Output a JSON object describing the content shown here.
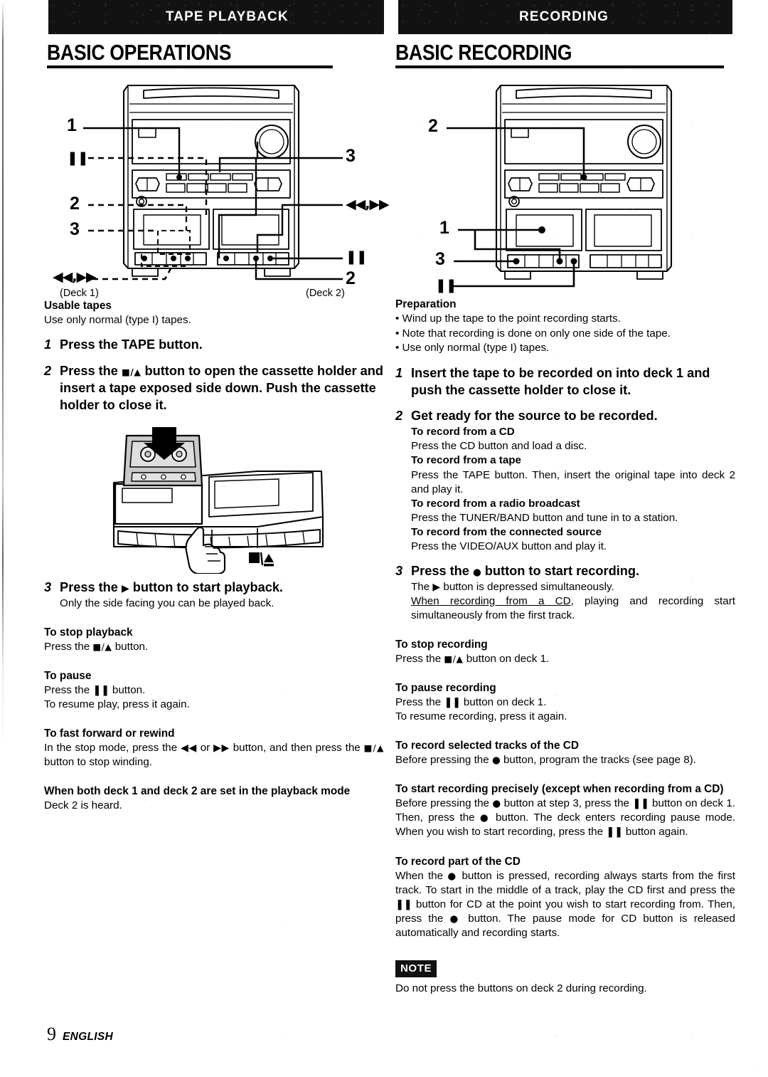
{
  "page": {
    "number": "9",
    "language": "ENGLISH"
  },
  "left_column": {
    "banner": "TAPE PLAYBACK",
    "heading": "BASIC OPERATIONS",
    "diagram": {
      "callouts": [
        {
          "id": "callout-1",
          "label": "1"
        },
        {
          "id": "callout-pause-deck1",
          "label": "❚❚"
        },
        {
          "id": "callout-2-left",
          "label": "2"
        },
        {
          "id": "callout-3-left",
          "label": "3"
        },
        {
          "id": "callout-ffrew-deck1",
          "label": "◀◀,▶▶"
        },
        {
          "id": "callout-3-right",
          "label": "3"
        },
        {
          "id": "callout-ffrew-deck2",
          "label": "◀◀,▶▶"
        },
        {
          "id": "callout-pause-deck2",
          "label": "❚❚"
        },
        {
          "id": "callout-2-right",
          "label": "2"
        }
      ],
      "deck1_label": "(Deck 1)",
      "deck2_label": "(Deck 2)",
      "cassette_button_label": "■/▲"
    },
    "usable_tapes": {
      "heading": "Usable tapes",
      "text": "Use only normal (type I) tapes."
    },
    "steps": [
      {
        "number": "1",
        "text": "Press the TAPE button."
      },
      {
        "number": "2",
        "text_before": "Press the ",
        "symbol": "■/▲",
        "text_after": " button to open the cassette holder and insert a tape exposed side down. Push the cassette holder to close it."
      },
      {
        "number": "3",
        "text_before": "Press the ",
        "symbol": "▶",
        "text_after": " button to start playback.",
        "sub": "Only the side facing you can be played back."
      }
    ],
    "sections": [
      {
        "heading": "To stop playback",
        "lines": [
          {
            "before": "Press the ",
            "symbol": "■/▲",
            "after": " button."
          }
        ]
      },
      {
        "heading": "To pause",
        "lines": [
          {
            "before": "Press the ",
            "symbol": "❚❚",
            "after": " button."
          },
          {
            "before": "To resume play, press it again.",
            "symbol": "",
            "after": ""
          }
        ]
      },
      {
        "heading": "To fast forward or rewind",
        "lines": [
          {
            "before": "In the stop mode, press the ",
            "symbol": "◀◀",
            "mid": " or ",
            "symbol2": "▶▶",
            "after": " button, and then press the ",
            "symbol3": "■/▲",
            "after2": " button to stop winding."
          }
        ]
      },
      {
        "heading": "When both deck 1 and deck 2 are set in the playback mode",
        "lines": [
          {
            "before": "Deck 2 is heard.",
            "symbol": "",
            "after": ""
          }
        ]
      }
    ]
  },
  "right_column": {
    "banner": "RECORDING",
    "heading": "BASIC RECORDING",
    "diagram": {
      "callouts": [
        {
          "id": "callout-2",
          "label": "2"
        },
        {
          "id": "callout-1",
          "label": "1"
        },
        {
          "id": "callout-3",
          "label": "3"
        },
        {
          "id": "callout-pause",
          "label": "❚❚"
        }
      ]
    },
    "preparation": {
      "heading": "Preparation",
      "bullets": [
        "• Wind up the tape to the point recording starts.",
        "• Note that recording is done on only one side of the tape.",
        "• Use only normal (type I) tapes."
      ]
    },
    "steps": [
      {
        "number": "1",
        "text": "Insert the tape to be recorded on into deck 1 and push the cassette holder to close it."
      },
      {
        "number": "2",
        "text": "Get ready for the source to be recorded.",
        "sources": [
          {
            "heading": "To record from a CD",
            "text": "Press the CD button and load a disc."
          },
          {
            "heading": "To record from a tape",
            "text": "Press the TAPE button. Then, insert the original tape into deck 2 and play it."
          },
          {
            "heading": "To record from a radio broadcast",
            "text": "Press the TUNER/BAND button and tune in to a station."
          },
          {
            "heading": "To record from the connected source",
            "text": "Press the VIDEO/AUX button and play it."
          }
        ]
      },
      {
        "number": "3",
        "text_before": "Press the ",
        "symbol": "●",
        "text_after": " button to start recording.",
        "sub_before": "The ",
        "sub_symbol": "▶",
        "sub_after": " button is depressed simultaneously.",
        "sub2_underlined": "When recording from a CD",
        "sub2_rest": ", playing and recording start simultaneously from the first track."
      }
    ],
    "sections": [
      {
        "heading": "To stop recording",
        "lines": [
          {
            "before": "Press the ",
            "symbol": "■/▲",
            "after": " button on deck 1."
          }
        ]
      },
      {
        "heading": "To pause recording",
        "lines": [
          {
            "before": "Press the ",
            "symbol": "❚❚",
            "after": " button on deck 1."
          },
          {
            "before": "To resume recording, press it again.",
            "symbol": "",
            "after": ""
          }
        ]
      },
      {
        "heading": "To record selected tracks of the CD",
        "lines": [
          {
            "before": "Before pressing the ",
            "symbol": "●",
            "after": " button, program the tracks (see page 8)."
          }
        ]
      },
      {
        "heading": "To start recording precisely (except when recording from a CD)",
        "lines": [
          {
            "before": "Before pressing the ",
            "symbol": "●",
            "mid": " button at step 3, press the ",
            "symbol2": "❚❚",
            "after": " button on deck 1. Then, press the ",
            "symbol3": "●",
            "after2": " button. The deck enters recording pause mode. When you wish to start recording, press the ",
            "symbol4": "❚❚",
            "after3": " button again."
          }
        ]
      },
      {
        "heading": "To record part of the CD",
        "lines": [
          {
            "before": "When the ",
            "symbol": "●",
            "mid": " button is pressed, recording always starts from the first track.  To start in the middle of a track, play the CD first and press the ",
            "symbol2": "❚❚",
            "after": " button for CD at the point you wish to start recording from.  Then, press the ",
            "symbol3": "●",
            "after2": " button.  The pause mode for CD button is released automatically and recording starts."
          }
        ]
      }
    ],
    "note": {
      "badge": "NOTE",
      "text": "Do not press the buttons on deck 2 during recording."
    }
  }
}
